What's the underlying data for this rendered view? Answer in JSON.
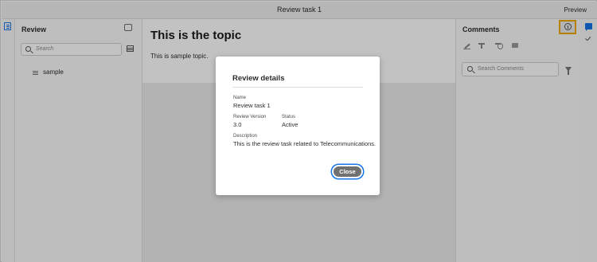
{
  "topbar": {
    "title": "Review task 1",
    "preview_label": "Preview"
  },
  "review_panel": {
    "heading": "Review",
    "search_placeholder": "Search",
    "tree": [
      {
        "label": "sample"
      }
    ]
  },
  "content": {
    "topic_title": "This is the topic",
    "topic_body": "This is sample topic."
  },
  "comments_panel": {
    "heading": "Comments",
    "search_placeholder": "Search Comments"
  },
  "modal": {
    "title": "Review details",
    "name_label": "Name",
    "name_value": "Review task 1",
    "version_label": "Review Version",
    "version_value": "3.0",
    "status_label": "Status",
    "status_value": "Active",
    "description_label": "Description",
    "description_value": "This is the review task related to Telecommunications.",
    "close_label": "Close"
  },
  "colors": {
    "accent": "#1473e6",
    "highlight": "#f2a900",
    "close_button": "#707070"
  },
  "icons": [
    "doc-icon",
    "add-comment-icon",
    "search-icon",
    "table-icon",
    "list-icon",
    "pencil-icon",
    "text-icon",
    "text-format-icon",
    "comment-bubble-icon",
    "filter-icon",
    "info-icon",
    "chat-icon",
    "checkmark-icon"
  ]
}
